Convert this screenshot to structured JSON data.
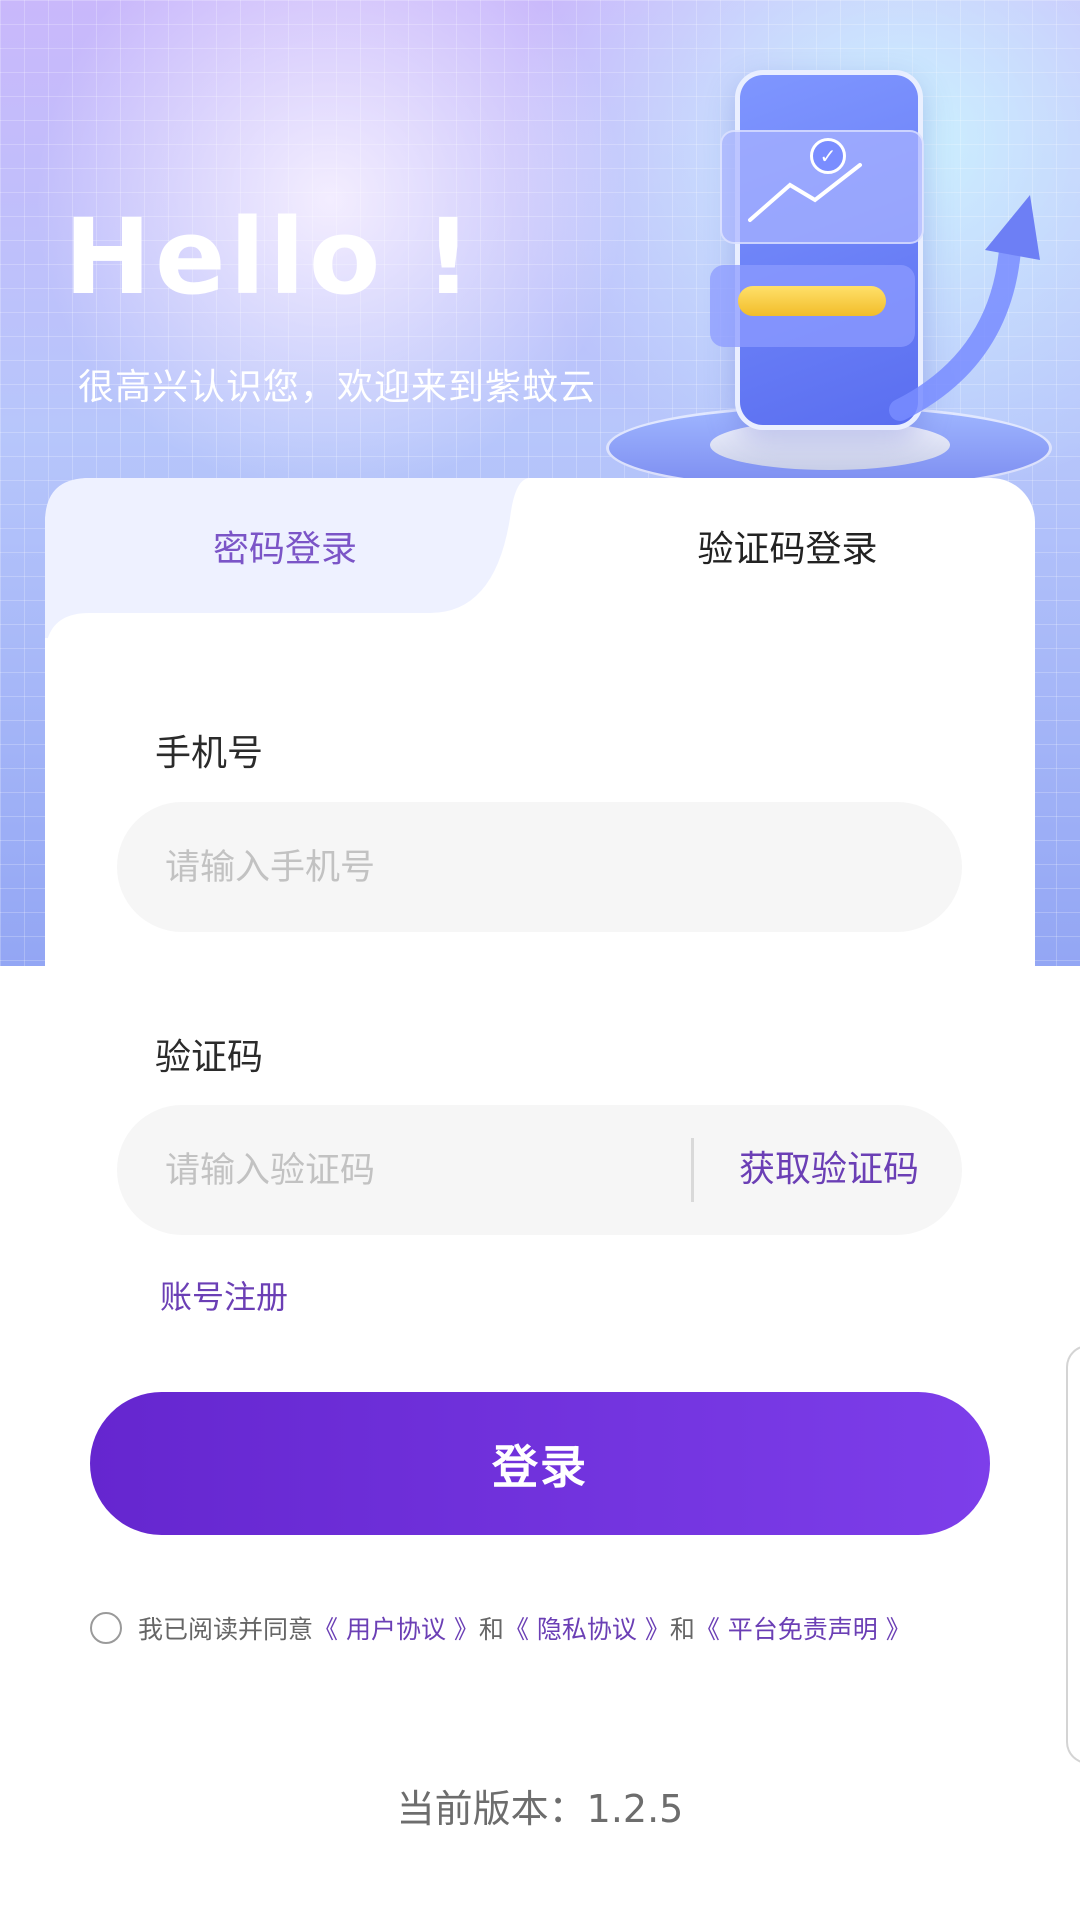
{
  "hero": {
    "title": "Hello !",
    "subtitle": "很高兴认识您，欢迎来到紫蚊云"
  },
  "tabs": {
    "password_login": "密码登录",
    "sms_login": "验证码登录",
    "active": "sms_login"
  },
  "form": {
    "phone_label": "手机号",
    "phone_placeholder": "请输入手机号",
    "phone_value": "",
    "code_label": "验证码",
    "code_placeholder": "请输入验证码",
    "code_value": "",
    "get_code": "获取验证码",
    "register": "账号注册"
  },
  "login_button": "登录",
  "agreement": {
    "checked": false,
    "prefix": "我已阅读并同意",
    "user_agreement": "《 用户协议 》",
    "and1": "和",
    "privacy_agreement": "《 隐私协议 》",
    "and2": "和",
    "disclaimer": "《 平台免责声明 》"
  },
  "version": "当前版本：1.2.5",
  "colors": {
    "accent": "#6b3fb5",
    "button_start": "#6526cf",
    "button_end": "#7d3eea"
  }
}
